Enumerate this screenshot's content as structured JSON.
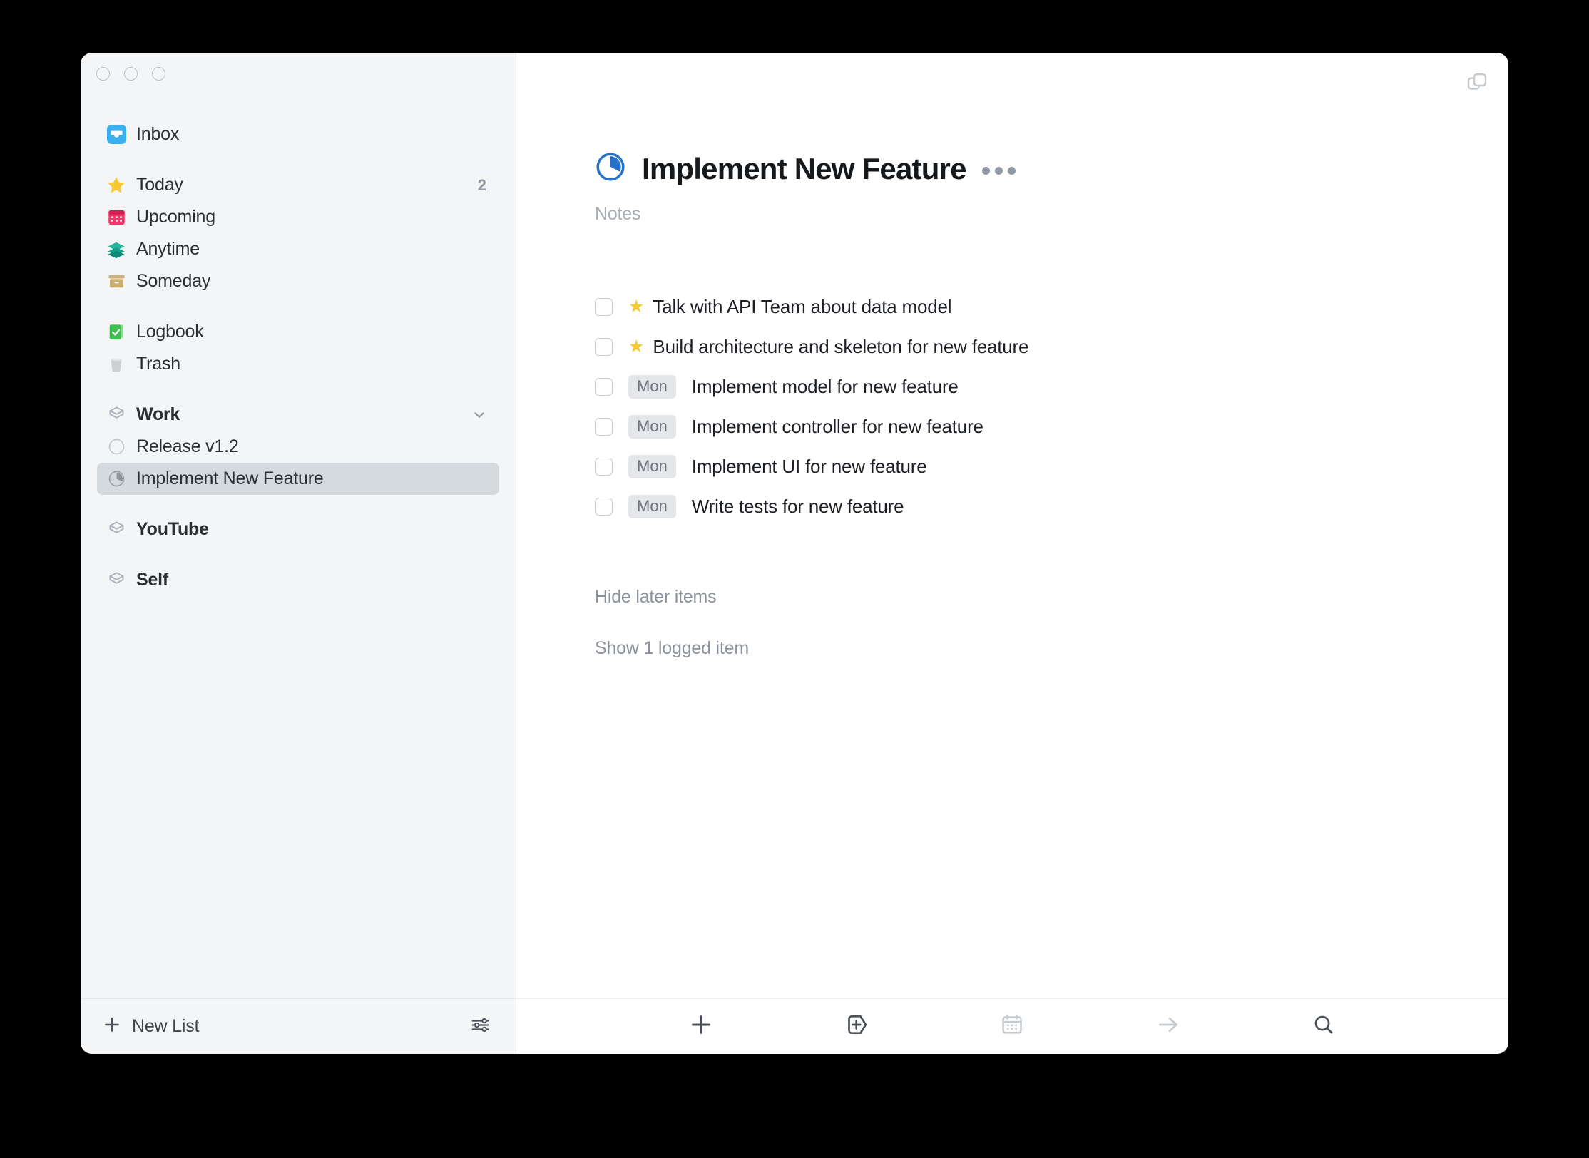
{
  "window": {
    "traffic_lights": [
      "close",
      "minimize",
      "zoom"
    ],
    "corner_button_icon": "duplicate-window-icon"
  },
  "colors": {
    "accent_blue": "#2572c8",
    "inbox_blue": "#3bb0f0",
    "star_yellow": "#f6c934",
    "upcoming_pink": "#f2356b",
    "anytime_teal": "#17a189",
    "someday_tan": "#c9b07b",
    "logbook_green": "#3fbd4e",
    "trash_gray": "#c4c8cc",
    "sidebar_bg": "#f3f5f6",
    "selected_row_bg": "#d5dadf",
    "badge_bg": "#e4e6e9",
    "muted_text": "#8c929b"
  },
  "sidebar": {
    "groups": [
      {
        "items": [
          {
            "label": "Inbox",
            "icon": "inbox-icon",
            "count": ""
          }
        ]
      },
      {
        "items": [
          {
            "label": "Today",
            "icon": "star-icon",
            "count": "2"
          },
          {
            "label": "Upcoming",
            "icon": "calendar-icon",
            "count": ""
          },
          {
            "label": "Anytime",
            "icon": "layers-icon",
            "count": ""
          },
          {
            "label": "Someday",
            "icon": "archive-box-icon",
            "count": ""
          }
        ]
      },
      {
        "items": [
          {
            "label": "Logbook",
            "icon": "logbook-icon",
            "count": ""
          },
          {
            "label": "Trash",
            "icon": "trash-icon",
            "count": ""
          }
        ]
      },
      {
        "items": [
          {
            "label": "Work",
            "icon": "area-hexagon-icon",
            "count": "",
            "bold": true,
            "chevron": true
          },
          {
            "label": "Release v1.2",
            "icon": "project-circle-empty-icon",
            "count": ""
          },
          {
            "label": "Implement New Feature",
            "icon": "project-circle-progress-icon",
            "count": "",
            "selected": true
          }
        ]
      },
      {
        "items": [
          {
            "label": "YouTube",
            "icon": "area-hexagon-icon",
            "count": "",
            "bold": true
          }
        ]
      },
      {
        "items": [
          {
            "label": "Self",
            "icon": "area-hexagon-icon",
            "count": "",
            "bold": true
          }
        ]
      }
    ],
    "footer": {
      "new_list_label": "New List",
      "new_list_icon": "plus-icon",
      "settings_icon": "sliders-icon"
    }
  },
  "main": {
    "project": {
      "title": "Implement New Feature",
      "icon": "project-circle-progress-icon",
      "progress_percent": 40,
      "more_menu_icon": "ellipsis-icon"
    },
    "notes_placeholder": "Notes",
    "todos": [
      {
        "text": "Talk with API Team about data model",
        "marker_type": "star",
        "marker": "★",
        "checked": false
      },
      {
        "text": "Build architecture and skeleton for new feature",
        "marker_type": "star",
        "marker": "★",
        "checked": false
      },
      {
        "text": "Implement model for new feature",
        "marker_type": "badge",
        "marker": "Mon",
        "checked": false
      },
      {
        "text": "Implement controller for new feature",
        "marker_type": "badge",
        "marker": "Mon",
        "checked": false
      },
      {
        "text": "Implement UI for new feature",
        "marker_type": "badge",
        "marker": "Mon",
        "checked": false
      },
      {
        "text": "Write tests for new feature",
        "marker_type": "badge",
        "marker": "Mon",
        "checked": false
      }
    ],
    "hide_later_label": "Hide later items",
    "show_logged_label": "Show 1 logged item",
    "toolbar": [
      {
        "icon": "plus-icon",
        "name": "new-todo-button",
        "muted": false
      },
      {
        "icon": "new-project-icon",
        "name": "new-project-button",
        "muted": false
      },
      {
        "icon": "calendar-icon",
        "name": "schedule-button",
        "muted": true
      },
      {
        "icon": "arrow-right-icon",
        "name": "move-button",
        "muted": true
      },
      {
        "icon": "search-icon",
        "name": "search-button",
        "muted": false
      }
    ]
  }
}
